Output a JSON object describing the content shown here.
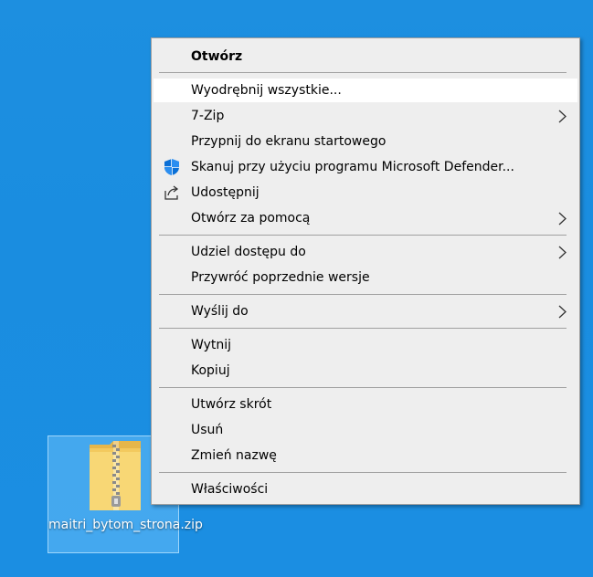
{
  "desktop": {
    "icon_label": "maitri_bytom_strona.zip",
    "icon": "zip-folder-icon",
    "background_color": "#1a8de0"
  },
  "menu": {
    "items": [
      {
        "label": "Otwórz",
        "bold": true
      },
      {
        "label": "Wyodrębnij wszystkie...",
        "highlighted": true
      },
      {
        "label": "7-Zip",
        "submenu": true
      },
      {
        "label": "Przypnij do ekranu startowego"
      },
      {
        "label": "Skanuj przy użyciu programu Microsoft Defender...",
        "icon": "defender-shield-icon"
      },
      {
        "label": "Udostępnij",
        "icon": "share-icon"
      },
      {
        "label": "Otwórz za pomocą",
        "submenu": true
      },
      {
        "label": "Udziel dostępu do",
        "submenu": true
      },
      {
        "label": "Przywróć poprzednie wersje"
      },
      {
        "label": "Wyślij do",
        "submenu": true
      },
      {
        "label": "Wytnij"
      },
      {
        "label": "Kopiuj"
      },
      {
        "label": "Utwórz skrót"
      },
      {
        "label": "Usuń"
      },
      {
        "label": "Zmień nazwę"
      },
      {
        "label": "Właściwości"
      }
    ]
  }
}
